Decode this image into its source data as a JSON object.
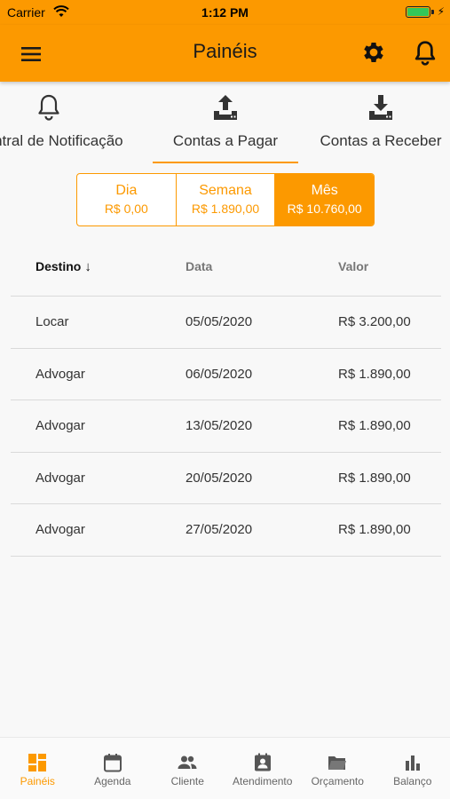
{
  "status_bar": {
    "carrier": "Carrier",
    "time": "1:12 PM"
  },
  "app_bar": {
    "title": "Painéis"
  },
  "tabs": [
    {
      "label": "Central de Notificação",
      "icon": "bell-outline-icon"
    },
    {
      "label": "Contas a Pagar",
      "icon": "upload-tray-icon",
      "active": true
    },
    {
      "label": "Contas a Receber",
      "icon": "download-tray-icon"
    }
  ],
  "period_toggle": [
    {
      "title": "Dia",
      "value": "R$ 0,00"
    },
    {
      "title": "Semana",
      "value": "R$ 1.890,00"
    },
    {
      "title": "Mês",
      "value": "R$ 10.760,00",
      "active": true
    }
  ],
  "table": {
    "headers": {
      "destino": "Destino",
      "data": "Data",
      "valor": "Valor"
    },
    "rows": [
      {
        "destino": "Locar",
        "data": "05/05/2020",
        "valor": "R$ 3.200,00"
      },
      {
        "destino": "Advogar",
        "data": "06/05/2020",
        "valor": "R$ 1.890,00"
      },
      {
        "destino": "Advogar",
        "data": "13/05/2020",
        "valor": "R$ 1.890,00"
      },
      {
        "destino": "Advogar",
        "data": "20/05/2020",
        "valor": "R$ 1.890,00"
      },
      {
        "destino": "Advogar",
        "data": "27/05/2020",
        "valor": "R$ 1.890,00"
      }
    ]
  },
  "bottom_nav": [
    {
      "label": "Painéis",
      "icon": "dashboard-icon",
      "active": true
    },
    {
      "label": "Agenda",
      "icon": "calendar-icon"
    },
    {
      "label": "Cliente",
      "icon": "people-icon"
    },
    {
      "label": "Atendimento",
      "icon": "contact-card-icon"
    },
    {
      "label": "Orçamento",
      "icon": "folder-icon"
    },
    {
      "label": "Balanço",
      "icon": "bar-chart-icon"
    }
  ],
  "colors": {
    "accent": "#fc9900",
    "battery": "#34c759"
  }
}
